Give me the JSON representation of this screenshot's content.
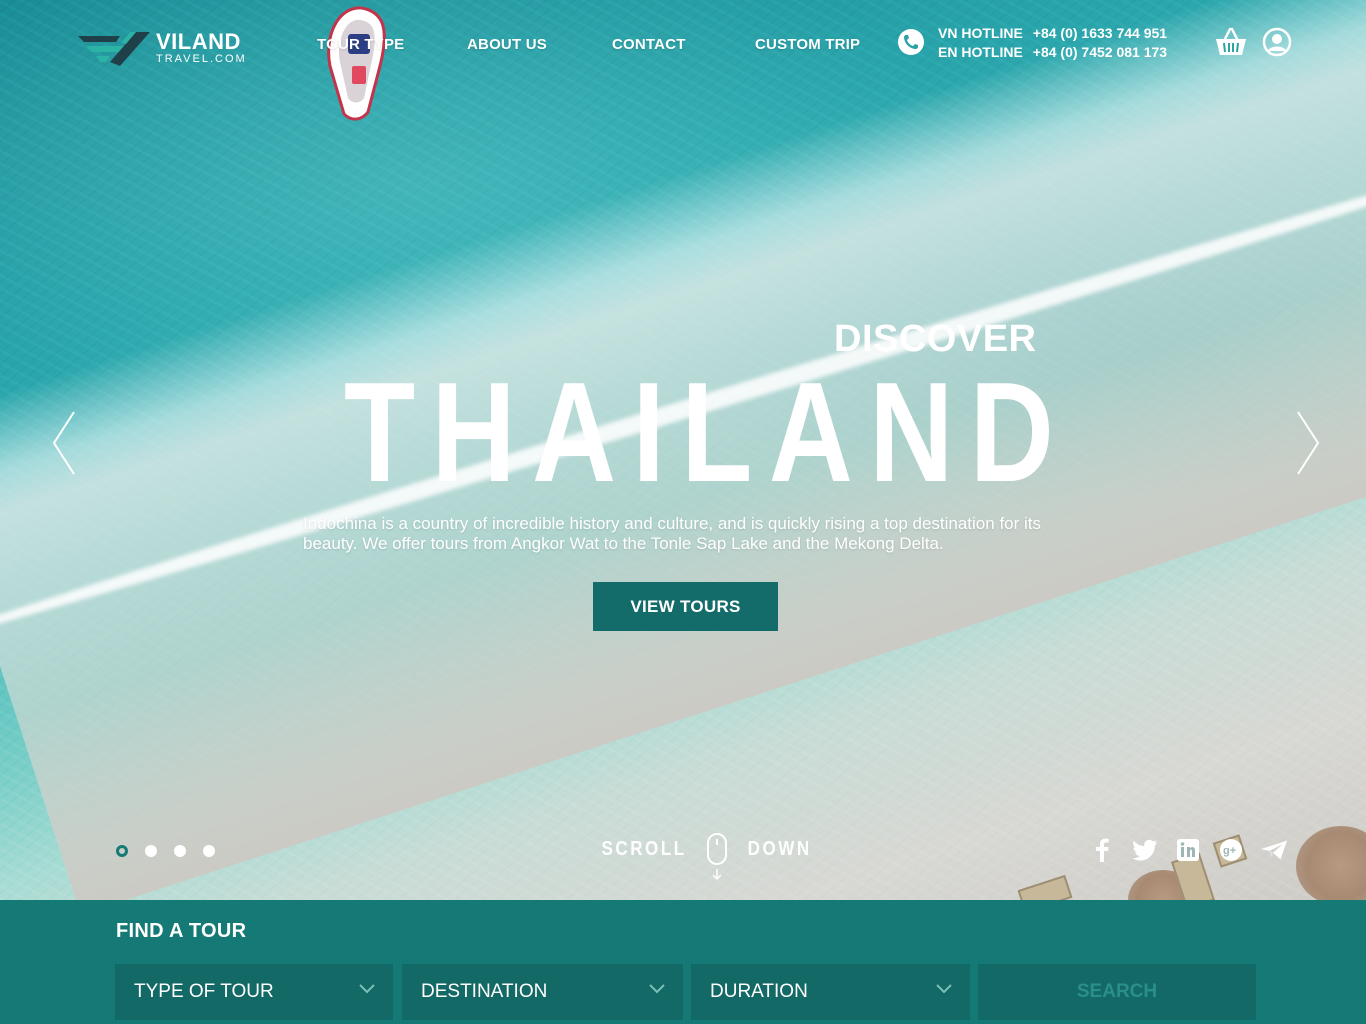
{
  "brand": {
    "name": "VILAND",
    "sub": "TRAVEL.COM",
    "accent": "#157a75"
  },
  "nav": {
    "items": [
      {
        "label": "TOUR TYPE"
      },
      {
        "label": "ABOUT US"
      },
      {
        "label": "CONTACT"
      },
      {
        "label": "CUSTOM TRIP"
      }
    ]
  },
  "hotlines": [
    {
      "label": "VN HOTLINE",
      "number": "+84 (0) 1633 744 951"
    },
    {
      "label": "EN HOTLINE",
      "number": "+84 (0) 7452 081 173"
    }
  ],
  "header_icons": {
    "phone": "phone-icon",
    "cart": "cart-icon",
    "user": "user-icon"
  },
  "hero": {
    "eyebrow": "DISCOVER",
    "headline": "THAILAND",
    "description": "Indochina is a country of incredible history and culture, and is quickly rising a top destination for its beauty. We offer tours from Angkor Wat  to the Tonle Sap Lake and the Mekong Delta.",
    "cta": "VIEW TOURS",
    "slides_total": 4,
    "active_slide": 1,
    "scroll_left": "SCROLL",
    "scroll_right": "DOWN"
  },
  "socials": [
    "facebook-icon",
    "twitter-icon",
    "linkedin-icon",
    "google-plus-icon",
    "telegram-icon"
  ],
  "finder": {
    "title": "FIND A TOUR",
    "type_of_tour": "TYPE OF TOUR",
    "destination": "DESTINATION",
    "duration": "DURATION",
    "search": "SEARCH"
  }
}
